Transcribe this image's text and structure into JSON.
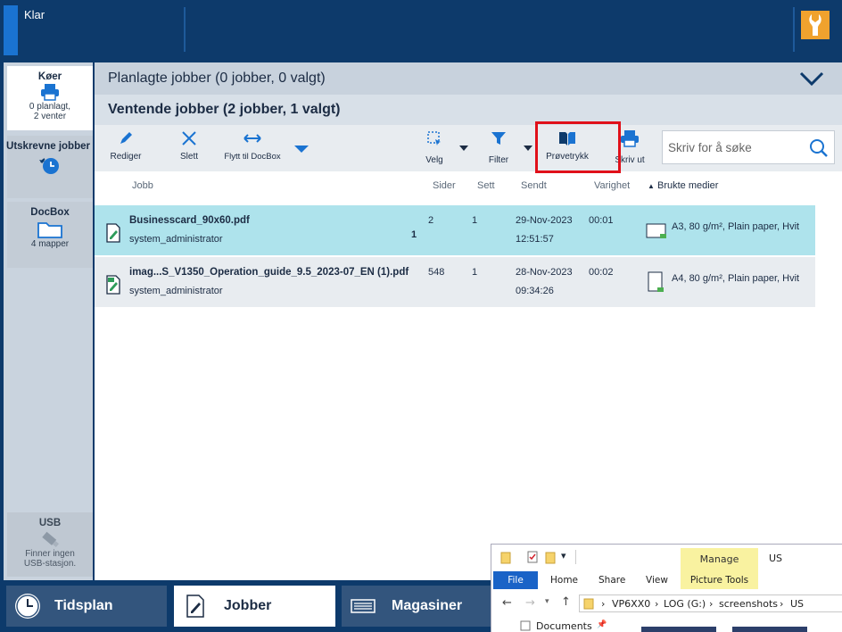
{
  "topbar": {
    "status": "Klar"
  },
  "sidebar": {
    "queues": {
      "title": "Køer",
      "line1": "0 planlagt,",
      "line2": "2 venter"
    },
    "printed": {
      "title": "Utskrevne jobber"
    },
    "docbox": {
      "title": "DocBox",
      "sub": "4 mapper"
    },
    "usb": {
      "title": "USB",
      "line1": "Finner ingen",
      "line2": "USB-stasjon."
    }
  },
  "main": {
    "planned_header": "Planlagte jobber (0 jobber, 0 valgt)",
    "waiting_header": "Ventende jobber (2 jobber, 1 valgt)",
    "toolbar": {
      "edit": "Rediger",
      "delete": "Slett",
      "move": "Flytt til DocBox",
      "select": "Velg",
      "filter": "Filter",
      "proof": "Prøvetrykk",
      "print": "Skriv ut",
      "search_placeholder": "Skriv for å søke"
    },
    "columns": {
      "job": "Jobb",
      "pages": "Sider",
      "sets": "Sett",
      "sent": "Sendt",
      "duration": "Varighet",
      "media": "Brukte medier"
    },
    "jobs": [
      {
        "name": "Businesscard_90x60.pdf",
        "owner": "system_administrator",
        "count": "1",
        "pages": "2",
        "sets": "1",
        "date": "29-Nov-2023",
        "time": "12:51:57",
        "duration": "00:01",
        "media": "A3, 80 g/m², Plain paper, Hvit",
        "selected": true
      },
      {
        "name": "imag...S_V1350_Operation_guide_9.5_2023-07_EN (1).pdf",
        "owner": "system_administrator",
        "count": "",
        "pages": "548",
        "sets": "1",
        "date": "28-Nov-2023",
        "time": "09:34:26",
        "duration": "00:02",
        "media": "A4, 80 g/m², Plain paper, Hvit",
        "selected": false
      }
    ]
  },
  "bottom_tabs": {
    "schedule": "Tidsplan",
    "jobs": "Jobber",
    "trays": "Magasiner"
  },
  "explorer": {
    "manage": "Manage",
    "picture_tools": "Picture Tools",
    "folder": "US",
    "menu": {
      "file": "File",
      "home": "Home",
      "share": "Share",
      "view": "View"
    },
    "path": {
      "p1": "VP6XX0",
      "p2": "LOG (G:)",
      "p3": "screenshots",
      "p4": "US"
    },
    "nav_item": "Documents"
  },
  "colors": {
    "dark_blue": "#0d3a6b",
    "selected_row": "#aee3ec",
    "highlight": "#e0101a",
    "wrench": "#f0a22e"
  }
}
